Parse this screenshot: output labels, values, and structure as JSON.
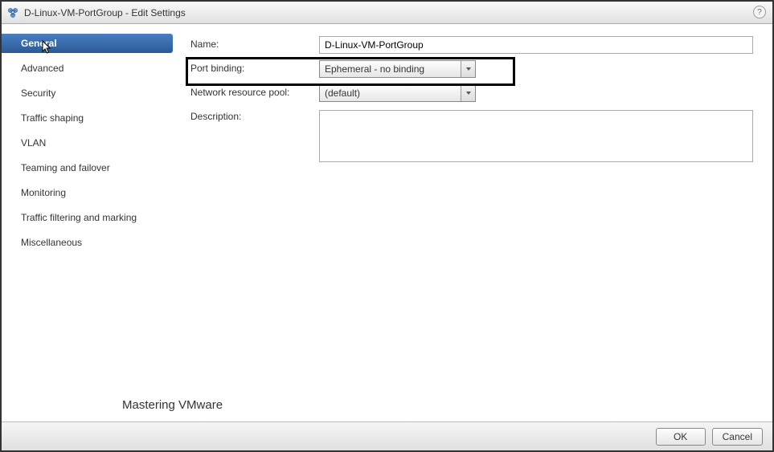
{
  "title": "D-Linux-VM-PortGroup - Edit Settings",
  "sidebar": {
    "items": [
      {
        "label": "General",
        "selected": true
      },
      {
        "label": "Advanced"
      },
      {
        "label": "Security"
      },
      {
        "label": "Traffic shaping"
      },
      {
        "label": "VLAN"
      },
      {
        "label": "Teaming and failover"
      },
      {
        "label": "Monitoring"
      },
      {
        "label": "Traffic filtering and marking"
      },
      {
        "label": "Miscellaneous"
      }
    ]
  },
  "form": {
    "name_label": "Name:",
    "name_value": "D-Linux-VM-PortGroup",
    "portbinding_label": "Port binding:",
    "portbinding_value": "Ephemeral - no binding",
    "netpool_label": "Network resource pool:",
    "netpool_value": "(default)",
    "description_label": "Description:",
    "description_value": ""
  },
  "footer": {
    "ok_label": "OK",
    "cancel_label": "Cancel"
  },
  "watermark": "Mastering VMware",
  "help_tooltip": "?"
}
